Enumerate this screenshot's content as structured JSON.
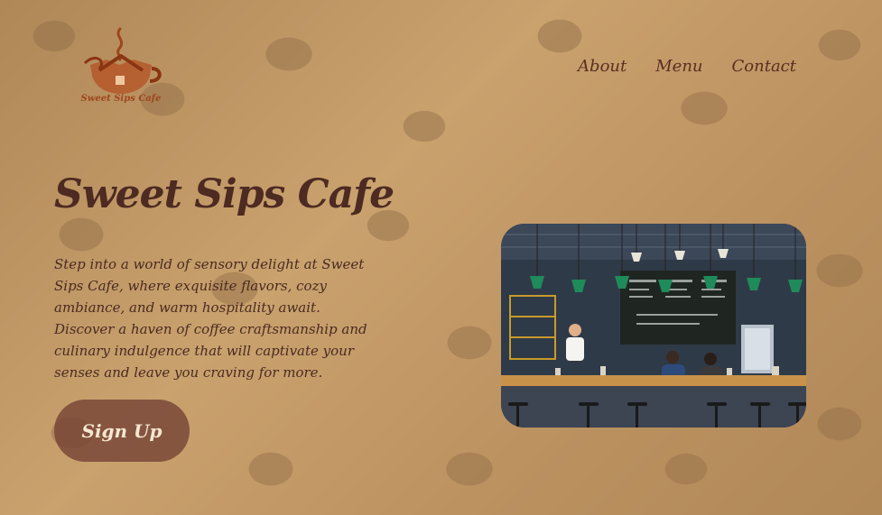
{
  "brand": {
    "logo_text": "Sweet Sips Cafe",
    "logo_icon": "coffee-cup-house-logo",
    "color": "#a0451b"
  },
  "nav": {
    "items": [
      {
        "label": "About"
      },
      {
        "label": "Menu"
      },
      {
        "label": "Contact"
      }
    ],
    "color": "#5a2e22"
  },
  "hero": {
    "title": "Sweet Sips Cafe",
    "description": "Step into a world of sensory delight at Sweet Sips Cafe, where exquisite flavors, cozy ambiance, and warm hospitality await. Discover a haven of coffee craftsmanship and culinary indulgence that will captivate your senses and leave you craving for more.",
    "cta_label": "Sign Up",
    "cta_color": "#784437",
    "image": "cafe-interior-photo"
  },
  "background": {
    "image": "coffee-beans-photo",
    "tint": "#debe8c"
  }
}
